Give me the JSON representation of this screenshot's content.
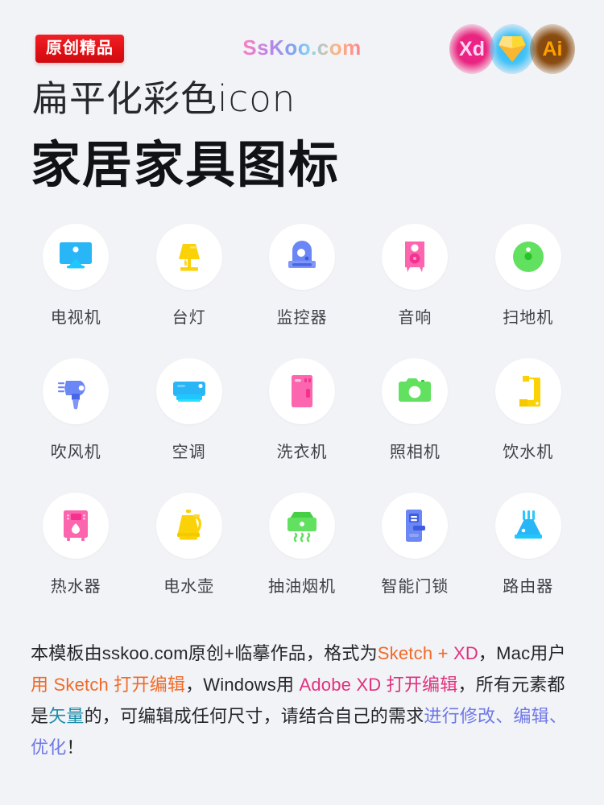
{
  "header": {
    "badge_label": "原创精品",
    "logo_text": "SsKoo.com",
    "app_badges": [
      {
        "name": "adobe-xd-badge",
        "label": "Xd",
        "color": "#e8257f"
      },
      {
        "name": "sketch-badge",
        "label": "",
        "color": "#29b6f6"
      },
      {
        "name": "adobe-illustrator-badge",
        "label": "Ai",
        "color": "#ffa000"
      }
    ]
  },
  "titles": {
    "subtitle": "扁平化彩色icon",
    "main": "家居家具图标"
  },
  "icons": [
    {
      "label": "电视机",
      "icon": "television-icon",
      "color": "#29b6f6"
    },
    {
      "label": "台灯",
      "icon": "desk-lamp-icon",
      "color": "#fad207"
    },
    {
      "label": "监控器",
      "icon": "security-monitor-icon",
      "color": "#6b86f5"
    },
    {
      "label": "音响",
      "icon": "speaker-icon",
      "color": "#fb66ae"
    },
    {
      "label": "扫地机",
      "icon": "robot-vacuum-icon",
      "color": "#62e060"
    },
    {
      "label": "吹风机",
      "icon": "hair-dryer-icon",
      "color": "#6b86f5"
    },
    {
      "label": "空调",
      "icon": "air-conditioner-icon",
      "color": "#29b6f6"
    },
    {
      "label": "洗衣机",
      "icon": "washing-machine-icon",
      "color": "#fb66ae"
    },
    {
      "label": "照相机",
      "icon": "camera-icon",
      "color": "#62e060"
    },
    {
      "label": "饮水机",
      "icon": "water-dispenser-icon",
      "color": "#fad207"
    },
    {
      "label": "热水器",
      "icon": "water-heater-icon",
      "color": "#fb66ae"
    },
    {
      "label": "电水壶",
      "icon": "electric-kettle-icon",
      "color": "#fad207"
    },
    {
      "label": "抽油烟机",
      "icon": "range-hood-icon",
      "color": "#62e060"
    },
    {
      "label": "智能门锁",
      "icon": "smart-door-lock-icon",
      "color": "#6b86f5"
    },
    {
      "label": "路由器",
      "icon": "wifi-router-icon",
      "color": "#29b6f6"
    }
  ],
  "footer": {
    "seg1": "本模板由sskoo.com原创+临摹作品，格式为",
    "seg2": "Sketch",
    "seg3": " + ",
    "seg4": "XD",
    "seg5": "，Mac用户",
    "seg6": "用 Sketch 打开编辑",
    "seg7": "，Windows用 ",
    "seg8": "Adobe XD 打开编辑",
    "seg9": "，所有元素都是",
    "seg10": "矢量",
    "seg11": "的，可编辑成任何尺寸，请结合自己的需求",
    "seg12": "进行修改、编辑、优化",
    "seg13": "！"
  },
  "colors": {
    "background": "#f2f3f6",
    "card": "#ffffff",
    "badge_red": "#e01015",
    "sketch_orange": "#f06a28",
    "xd_pink": "#e0317f",
    "vector_teal": "#1b8ca8",
    "final_purple": "#6f78e8"
  }
}
